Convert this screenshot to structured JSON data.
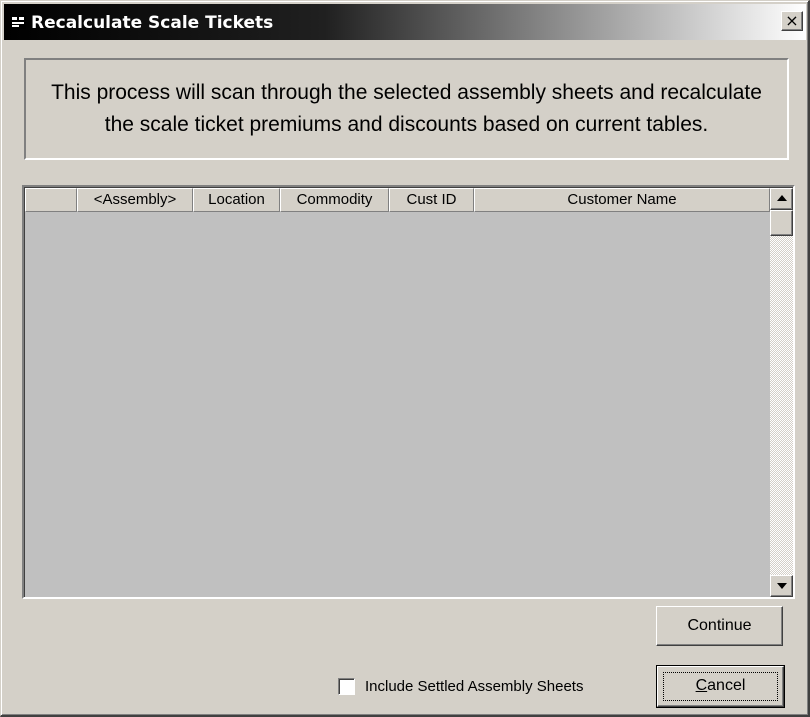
{
  "window": {
    "title": "Recalculate Scale Tickets",
    "close_glyph": "×",
    "title_icon": "app-window-icon"
  },
  "message": "This process will scan through the selected assembly sheets and recalculate the scale ticket premiums and discounts based on current tables.",
  "grid": {
    "columns": [
      "",
      "<Assembly>",
      "Location",
      "Commodity",
      "Cust ID",
      "Customer Name"
    ],
    "rows": []
  },
  "buttons": {
    "continue": "Continue",
    "cancel_prefix": "",
    "cancel_underline": "C",
    "cancel_rest": "ancel"
  },
  "options": {
    "include_settled_label": "Include Settled Assembly Sheets",
    "include_settled_checked": false
  },
  "colors": {
    "face": "#d4d0c8",
    "grid_bg": "#c0c0c0",
    "title_bar_start": "#000000",
    "title_bar_end": "#ffffff"
  }
}
